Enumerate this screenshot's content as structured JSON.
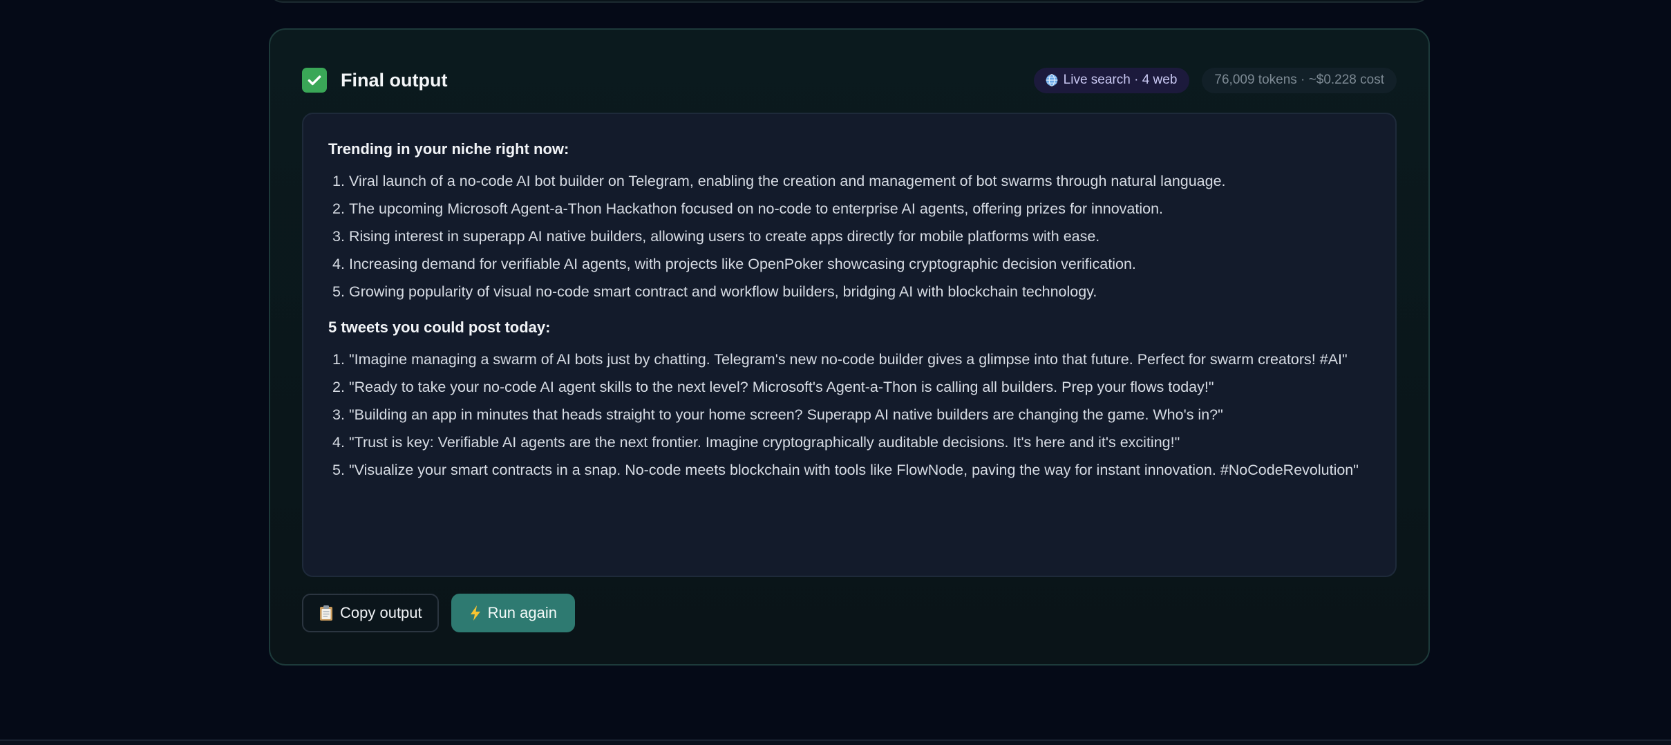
{
  "card": {
    "title": "Final output",
    "badges": {
      "live_search": "Live search · 4 web",
      "usage": "76,009 tokens · ~$0.228 cost"
    }
  },
  "output": {
    "trending_title": "Trending in your niche right now:",
    "trending": [
      "Viral launch of a no-code AI bot builder on Telegram, enabling the creation and management of bot swarms through natural language.",
      "The upcoming Microsoft Agent-a-Thon Hackathon focused on no-code to enterprise AI agents, offering prizes for innovation.",
      "Rising interest in superapp AI native builders, allowing users to create apps directly for mobile platforms with ease.",
      "Increasing demand for verifiable AI agents, with projects like OpenPoker showcasing cryptographic decision verification.",
      "Growing popularity of visual no-code smart contract and workflow builders, bridging AI with blockchain technology."
    ],
    "tweets_title": "5 tweets you could post today:",
    "tweets": [
      "\"Imagine managing a swarm of AI bots just by chatting. Telegram's new no-code builder gives a glimpse into that future. Perfect for swarm creators! #AI\"",
      "\"Ready to take your no-code AI agent skills to the next level? Microsoft's Agent-a-Thon is calling all builders. Prep your flows today!\"",
      "\"Building an app in minutes that heads straight to your home screen? Superapp AI native builders are changing the game. Who's in?\"",
      "\"Trust is key: Verifiable AI agents are the next frontier. Imagine cryptographically auditable decisions. It's here and it's exciting!\"",
      "\"Visualize your smart contracts in a snap. No-code meets blockchain with tools like FlowNode, paving the way for instant innovation. #NoCodeRevolution\""
    ]
  },
  "actions": {
    "copy_label": "Copy output",
    "run_label": "Run again"
  },
  "numbers": [
    "1.",
    "2.",
    "3.",
    "4.",
    "5."
  ],
  "icons": {
    "title": "check-mark-icon",
    "live_search": "globe-icon",
    "copy": "clipboard-icon",
    "run": "lightning-icon"
  },
  "colors": {
    "accent": "#2e7a71",
    "success": "#3aa757",
    "live_badge_bg": "#1c1a3c"
  }
}
